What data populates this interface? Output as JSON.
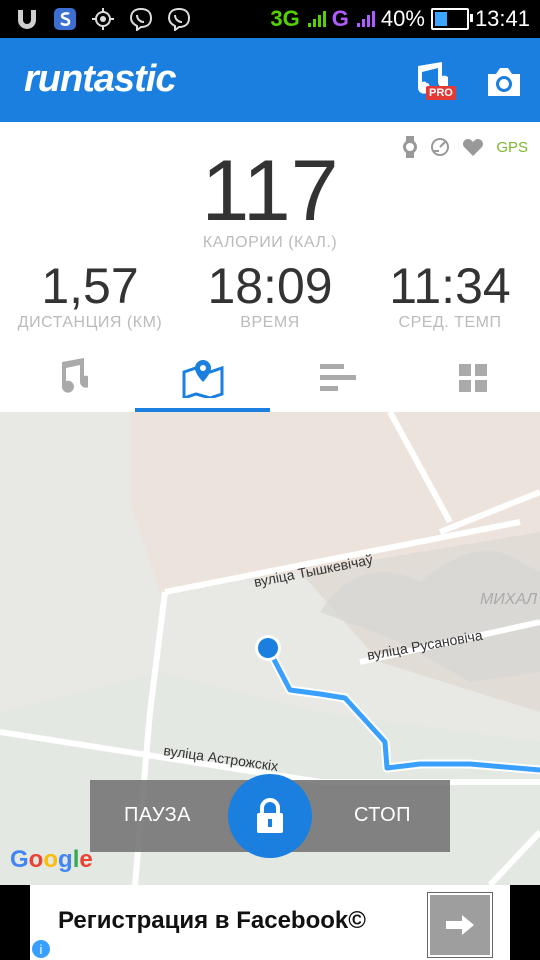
{
  "status_bar": {
    "network_3g": "3G",
    "network_g": "G",
    "battery": "40%",
    "battery_level": 0.4,
    "time": "13:41",
    "icons": [
      "usb-icon",
      "s-logo-icon",
      "gps-icon",
      "viber-icon",
      "viber-icon"
    ]
  },
  "app_bar": {
    "logo": "runtastic",
    "pro_badge": "PRO",
    "icons": [
      "music-pro-icon",
      "camera-icon"
    ],
    "color": "#1b7fe0"
  },
  "stats": {
    "sensors": [
      "watch-icon",
      "speed-icon",
      "heart-icon"
    ],
    "gps_label": "GPS",
    "calories": {
      "value": "117",
      "label": "КАЛОРИИ (КАЛ.)"
    },
    "distance": {
      "value": "1,57",
      "label": "ДИСТАНЦИЯ (КМ)"
    },
    "duration": {
      "value": "18:09",
      "label": "ВРЕМЯ"
    },
    "pace": {
      "value": "11:34",
      "label": "СРЕД. ТЕМП"
    }
  },
  "tabs": [
    {
      "icon": "music-note-icon",
      "active": false
    },
    {
      "icon": "map-icon",
      "active": true
    },
    {
      "icon": "bars-icon",
      "active": false
    },
    {
      "icon": "grid-icon",
      "active": false
    }
  ],
  "map": {
    "streets": [
      "вуліца Тышкевічаў",
      "вуліца Русановіча",
      "вуліца Астрожскіх"
    ],
    "district": "МИХАЛ",
    "provider": "Google"
  },
  "controls": {
    "pause": "ПАУЗА",
    "stop": "СТОП",
    "lock_icon": "lock-icon"
  },
  "ad": {
    "text": "Регистрация в Facebook©",
    "info": "i",
    "arrow_icon": "arrow-right-icon"
  }
}
